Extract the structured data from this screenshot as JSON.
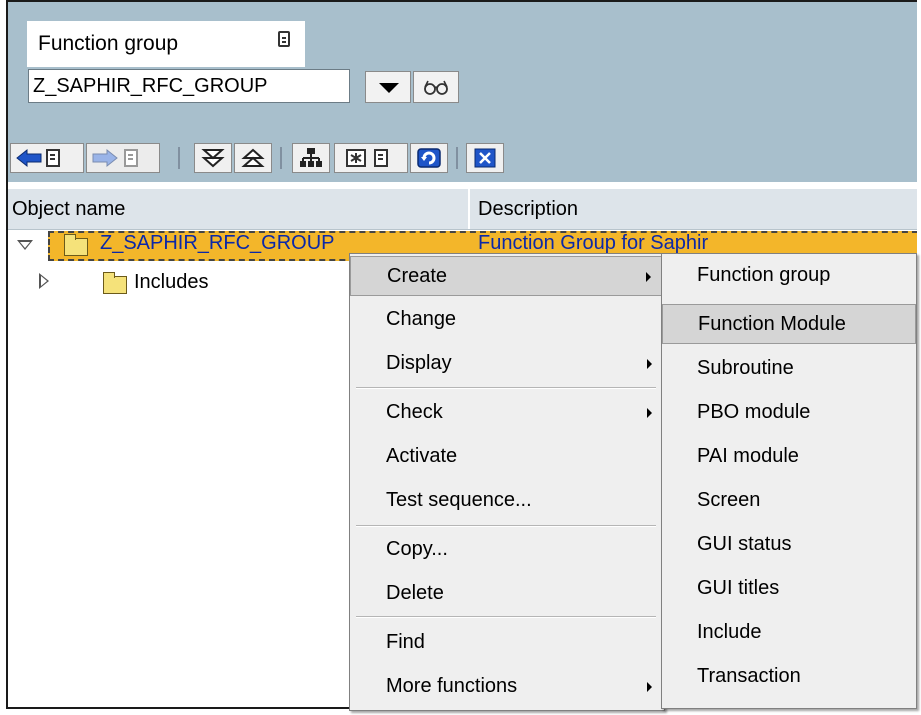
{
  "selection": {
    "label": "Function group",
    "value": "Z_SAPHIR_RFC_GROUP"
  },
  "columns": {
    "name": "Object name",
    "description": "Description"
  },
  "tree": {
    "root": {
      "name": "Z_SAPHIR_RFC_GROUP",
      "description": "Function Group for Saphir"
    },
    "child": {
      "name": "Includes"
    }
  },
  "context_menu": {
    "items": [
      {
        "label": "Create",
        "submenu": true
      },
      {
        "label": "Change",
        "submenu": false
      },
      {
        "label": "Display",
        "submenu": true
      },
      {
        "label": "Check",
        "submenu": true
      },
      {
        "label": "Activate",
        "submenu": false
      },
      {
        "label": "Test sequence...",
        "submenu": false
      },
      {
        "label": "Copy...",
        "submenu": false
      },
      {
        "label": "Delete",
        "submenu": false
      },
      {
        "label": "Find",
        "submenu": false
      },
      {
        "label": "More functions",
        "submenu": true
      }
    ],
    "highlighted": "Create"
  },
  "create_submenu": {
    "items": [
      {
        "label": "Function group"
      },
      {
        "label": "Function Module"
      },
      {
        "label": "Subroutine"
      },
      {
        "label": "PBO module"
      },
      {
        "label": "PAI module"
      },
      {
        "label": "Screen"
      },
      {
        "label": "GUI status"
      },
      {
        "label": "GUI titles"
      },
      {
        "label": "Include"
      },
      {
        "label": "Transaction"
      }
    ],
    "highlighted": "Function Module"
  },
  "toolbar_icons": [
    "back-icon",
    "forward-icon",
    "expand-icon",
    "collapse-icon",
    "hierarchy-icon",
    "select-icon",
    "refresh-icon",
    "close-icon"
  ],
  "colors": {
    "top_bg": "#a8bfcc",
    "selection_bg": "#f3b62a",
    "link_blue": "#0b28a8"
  }
}
